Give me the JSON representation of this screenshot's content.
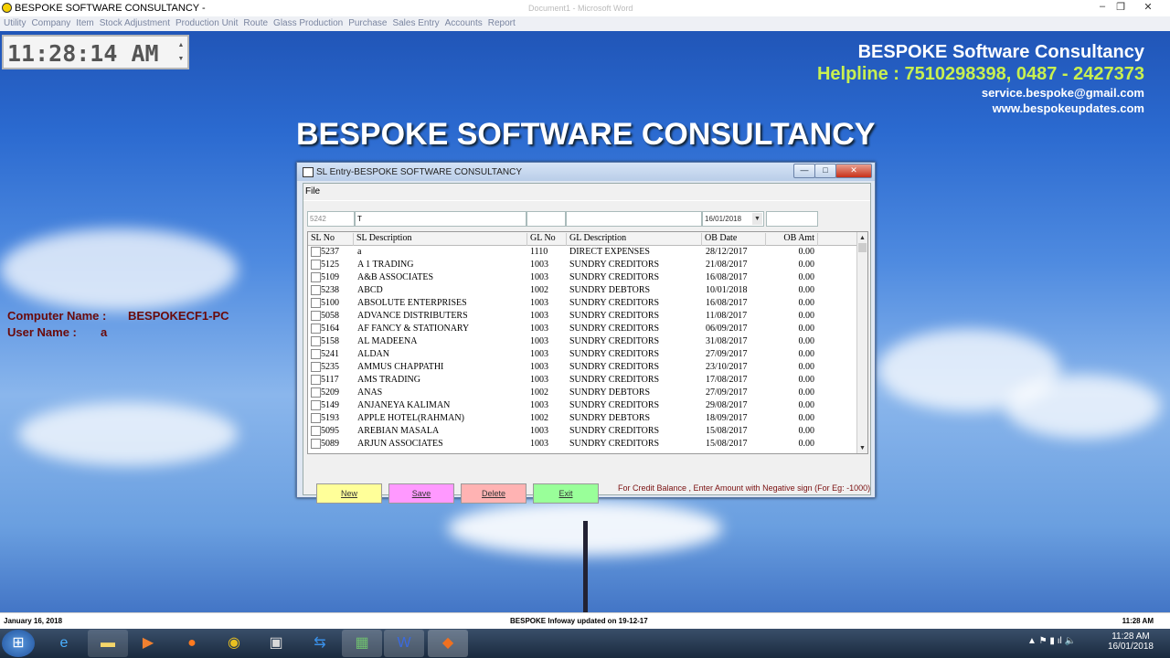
{
  "window": {
    "title": "BESPOKE SOFTWARE CONSULTANCY -",
    "doc_title": "Document1 - Microsoft Word"
  },
  "menu": [
    "Utility",
    "Company",
    "Item",
    "Stock Adjustment",
    "Production Unit",
    "Route",
    "Glass Production",
    "Purchase",
    "Sales Entry",
    "Accounts",
    "Report"
  ],
  "clock": "11:28:14 AM",
  "brand": {
    "name": "BESPOKE Software Consultancy",
    "helpline": "Helpline : 7510298398, 0487 - 2427373",
    "email": "service.bespoke@gmail.com",
    "web": "www.bespokeupdates.com",
    "banner": "BESPOKE SOFTWARE CONSULTANCY"
  },
  "computer": {
    "label": "Computer Name :",
    "value": "BESPOKECF1-PC",
    "user_label": "User Name :",
    "user_value": "a"
  },
  "dialog": {
    "title": "SL Entry-BESPOKE SOFTWARE CONSULTANCY",
    "file_menu": "File",
    "inputs": {
      "sl_no": "5242",
      "sl_desc": "T",
      "date": "16/01/2018"
    },
    "columns": [
      "SL No",
      "SL Description",
      "GL No",
      "GL Description",
      "OB Date",
      "OB Amt"
    ],
    "rows": [
      [
        "5237",
        "a",
        "1110",
        "DIRECT EXPENSES",
        "28/12/2017",
        "0.00"
      ],
      [
        "5125",
        "A 1 TRADING",
        "1003",
        "SUNDRY CREDITORS",
        "21/08/2017",
        "0.00"
      ],
      [
        "5109",
        "A&B ASSOCIATES",
        "1003",
        "SUNDRY CREDITORS",
        "16/08/2017",
        "0.00"
      ],
      [
        "5238",
        "ABCD",
        "1002",
        "SUNDRY DEBTORS",
        "10/01/2018",
        "0.00"
      ],
      [
        "5100",
        "ABSOLUTE ENTERPRISES",
        "1003",
        "SUNDRY CREDITORS",
        "16/08/2017",
        "0.00"
      ],
      [
        "5058",
        "ADVANCE DISTRIBUTERS",
        "1003",
        "SUNDRY CREDITORS",
        "11/08/2017",
        "0.00"
      ],
      [
        "5164",
        "AF FANCY & STATIONARY",
        "1003",
        "SUNDRY CREDITORS",
        "06/09/2017",
        "0.00"
      ],
      [
        "5158",
        "AL MADEENA",
        "1003",
        "SUNDRY CREDITORS",
        "31/08/2017",
        "0.00"
      ],
      [
        "5241",
        "ALDAN",
        "1003",
        "SUNDRY CREDITORS",
        "27/09/2017",
        "0.00"
      ],
      [
        "5235",
        "AMMUS CHAPPATHI",
        "1003",
        "SUNDRY CREDITORS",
        "23/10/2017",
        "0.00"
      ],
      [
        "5117",
        "AMS TRADING",
        "1003",
        "SUNDRY CREDITORS",
        "17/08/2017",
        "0.00"
      ],
      [
        "5209",
        "ANAS",
        "1002",
        "SUNDRY DEBTORS",
        "27/09/2017",
        "0.00"
      ],
      [
        "5149",
        "ANJANEYA KALIMAN",
        "1003",
        "SUNDRY CREDITORS",
        "29/08/2017",
        "0.00"
      ],
      [
        "5193",
        "APPLE HOTEL(RAHMAN)",
        "1002",
        "SUNDRY DEBTORS",
        "18/09/2017",
        "0.00"
      ],
      [
        "5095",
        "AREBIAN MASALA",
        "1003",
        "SUNDRY CREDITORS",
        "15/08/2017",
        "0.00"
      ],
      [
        "5089",
        "ARJUN ASSOCIATES",
        "1003",
        "SUNDRY CREDITORS",
        "15/08/2017",
        "0.00"
      ]
    ],
    "buttons": {
      "new": "New",
      "save": "Save",
      "delete": "Delete",
      "exit": "Exit"
    },
    "note": "For Credit Balance , Enter Amount with Negative sign (For Eg: -1000)",
    "colors": {
      "new": "#ffff99",
      "save": "#ff99ff",
      "delete": "#ffb3b3",
      "exit": "#99ff99"
    }
  },
  "status": {
    "date": "January 16, 2018",
    "message": "BESPOKE Infoway updated on 19-12-17",
    "time": "11:28 AM"
  },
  "taskbar": {
    "time": "11:28 AM",
    "date": "16/01/2018",
    "icons": [
      "start-orb-icon",
      "ie-icon",
      "explorer-icon",
      "media-player-icon",
      "firefox-icon",
      "chrome-icon",
      "remote-desktop-icon",
      "teamviewer-icon",
      "app-icon",
      "word-icon",
      "bespoke-app-icon"
    ]
  }
}
